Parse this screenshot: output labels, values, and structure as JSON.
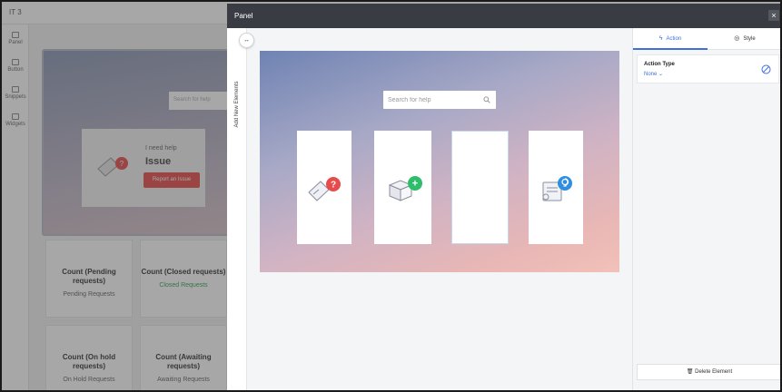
{
  "background_app": {
    "title": "IT 3",
    "left_nav": [
      {
        "label": "Panel"
      },
      {
        "label": "Button"
      },
      {
        "label": "Snippets"
      },
      {
        "label": "Widgets"
      }
    ],
    "search_placeholder": "Search for help",
    "card": {
      "line1": "I need help",
      "line2": "Issue",
      "button": "Report an Issue"
    },
    "tiles": [
      {
        "title": "Count (Pending requests)",
        "subtitle": "Pending Requests"
      },
      {
        "title": "Count (Closed requests)",
        "subtitle": "Closed Requests"
      },
      {
        "title": "Count (On hold requests)",
        "subtitle": "On Hold Requests"
      },
      {
        "title": "Count (Awaiting requests)",
        "subtitle": "Awaiting Requests"
      }
    ]
  },
  "panel": {
    "title": "Panel",
    "close_symbol": "×",
    "expand_symbol": "↔",
    "add_elements_label": "Add New Elements",
    "preview": {
      "search_placeholder": "Search for help",
      "tiles_count": 4
    },
    "tabs": [
      {
        "label": "Action",
        "icon": "lightning-icon",
        "active": true
      },
      {
        "label": "Style",
        "icon": "palette-icon",
        "active": false
      }
    ],
    "action": {
      "label": "Action Type",
      "value": "None"
    },
    "delete_label": "Delete Element"
  },
  "colors": {
    "header": "#3a3c43",
    "accent": "#3f6fd8",
    "danger": "#e84b4b",
    "success": "#2ebd6b",
    "info": "#2f8ee0",
    "closed_green": "#38a05c"
  }
}
